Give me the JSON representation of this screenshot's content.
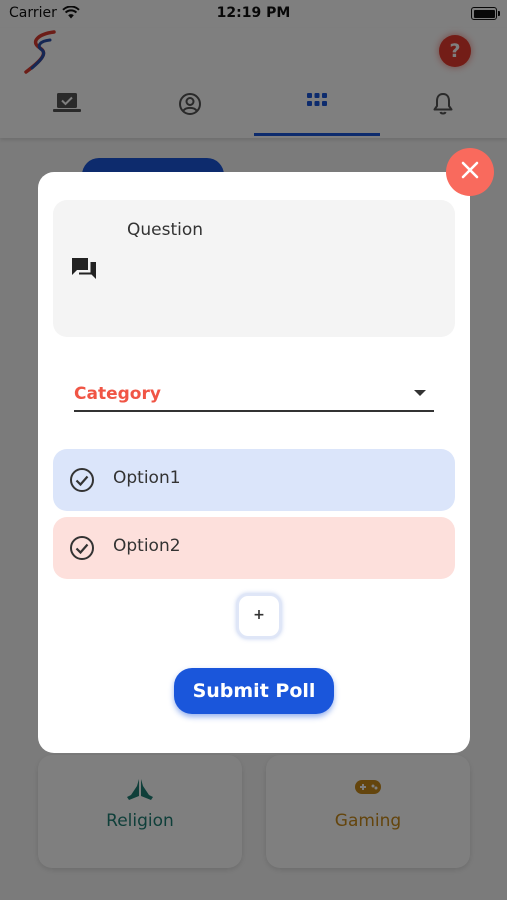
{
  "status_bar": {
    "carrier": "Carrier",
    "time": "12:19 PM"
  },
  "header": {
    "help_label": "?",
    "tabs": [
      {
        "name": "tab-home",
        "icon": "laptop-check-icon",
        "active": false
      },
      {
        "name": "tab-profile",
        "icon": "account-circle-icon",
        "active": false
      },
      {
        "name": "tab-categories",
        "icon": "grid-icon",
        "active": true
      },
      {
        "name": "tab-notifications",
        "icon": "bell-icon",
        "active": false
      }
    ]
  },
  "background": {
    "cards": [
      {
        "label": "Religion",
        "icon": "praying-hands-icon",
        "color": "#1e7f74"
      },
      {
        "label": "Gaming",
        "icon": "gamepad-icon",
        "color": "#c98a1a"
      }
    ]
  },
  "poll_modal": {
    "question_label": "Question",
    "category_label": "Category",
    "options": [
      {
        "label": "Option1",
        "color": "#dbe5fa"
      },
      {
        "label": "Option2",
        "color": "#fde0dc"
      }
    ],
    "add_option_label": "+",
    "submit_label": "Submit Poll"
  },
  "colors": {
    "accent": "#1a56db",
    "close": "#f96a5d",
    "category": "#f05545"
  }
}
